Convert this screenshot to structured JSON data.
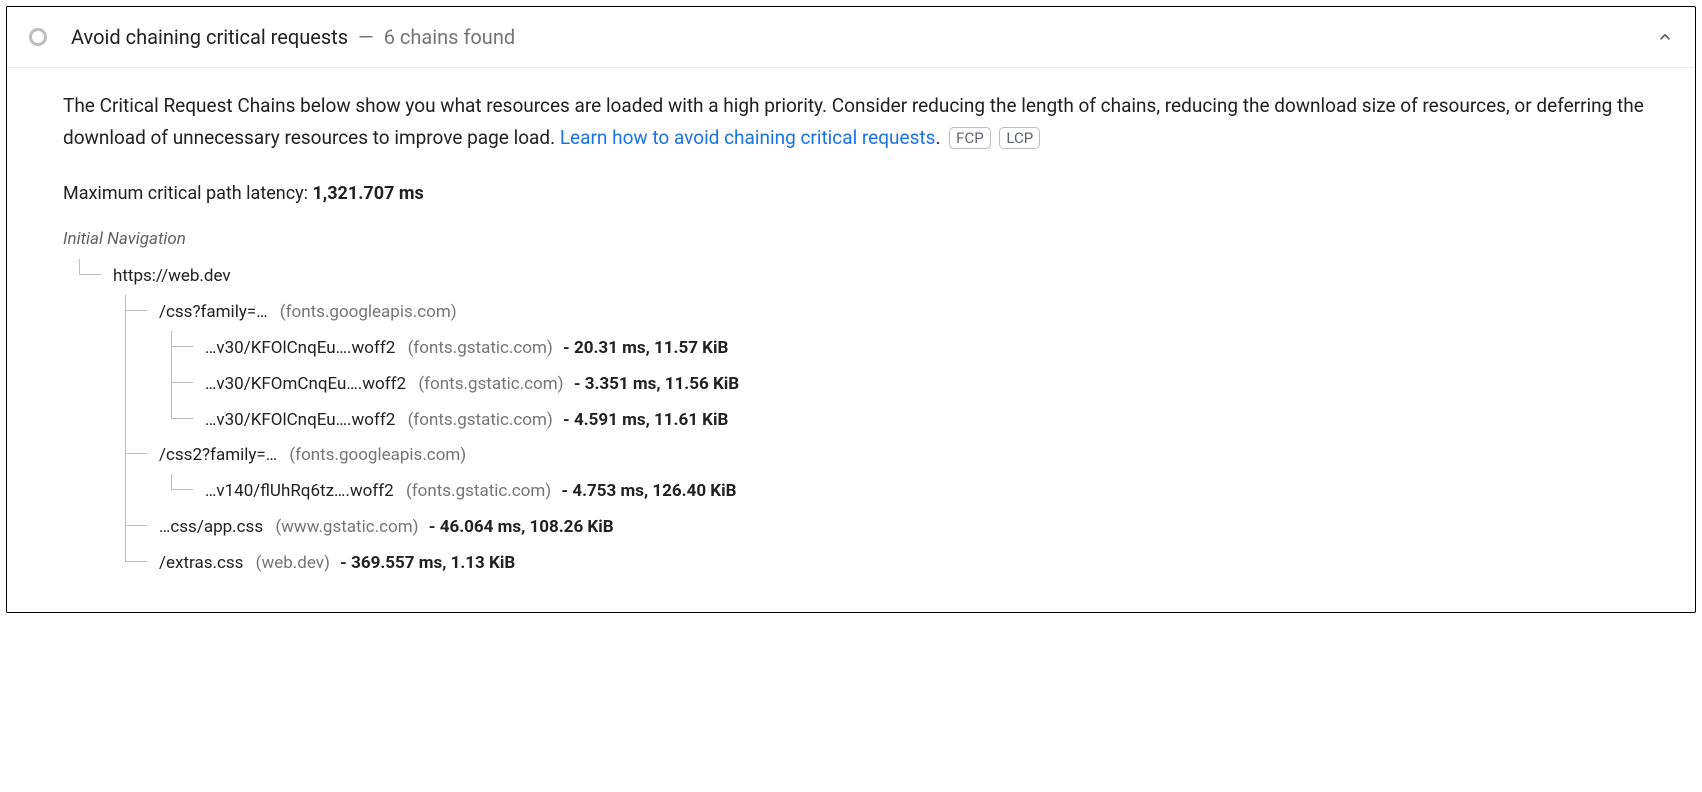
{
  "audit": {
    "title": "Avoid chaining critical requests",
    "separator": "—",
    "summary": "6 chains found",
    "collapse_icon": "chevron-up"
  },
  "description": {
    "text_before_link": "The Critical Request Chains below show you what resources are loaded with a high priority. Consider reducing the length of chains, reducing the download size of resources, or deferring the download of unnecessary resources to improve page load. ",
    "link_text": "Learn how to avoid chaining critical requests",
    "text_after_link": ".",
    "pills": [
      "FCP",
      "LCP"
    ]
  },
  "latency": {
    "label": "Maximum critical path latency: ",
    "value": "1,321.707 ms"
  },
  "tree": {
    "root_label": "Initial Navigation",
    "nodes": {
      "n0": {
        "url": "https://web.dev",
        "origin": "",
        "stats": ""
      },
      "n1": {
        "url": "/css?family=…",
        "origin": "(fonts.googleapis.com)",
        "stats": ""
      },
      "n1a": {
        "url": "…v30/KFOlCnqEu….woff2",
        "origin": "(fonts.gstatic.com)",
        "stats": "- 20.31 ms, 11.57 KiB"
      },
      "n1b": {
        "url": "…v30/KFOmCnqEu….woff2",
        "origin": "(fonts.gstatic.com)",
        "stats": "- 3.351 ms, 11.56 KiB"
      },
      "n1c": {
        "url": "…v30/KFOlCnqEu….woff2",
        "origin": "(fonts.gstatic.com)",
        "stats": "- 4.591 ms, 11.61 KiB"
      },
      "n2": {
        "url": "/css2?family=…",
        "origin": "(fonts.googleapis.com)",
        "stats": ""
      },
      "n2a": {
        "url": "…v140/flUhRq6tz….woff2",
        "origin": "(fonts.gstatic.com)",
        "stats": "- 4.753 ms, 126.40 KiB"
      },
      "n3": {
        "url": "…css/app.css",
        "origin": "(www.gstatic.com)",
        "stats": "- 46.064 ms, 108.26 KiB"
      },
      "n4": {
        "url": "/extras.css",
        "origin": "(web.dev)",
        "stats": "- 369.557 ms, 1.13 KiB"
      }
    }
  }
}
